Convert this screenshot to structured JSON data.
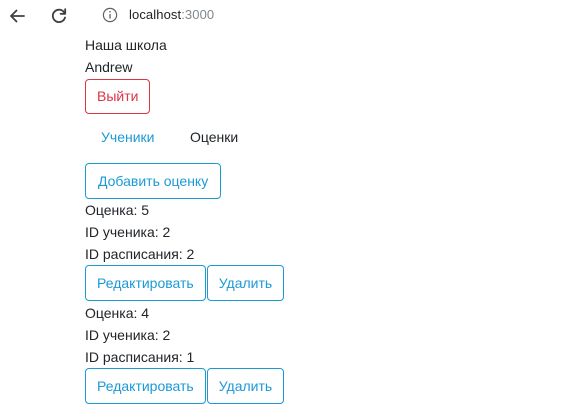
{
  "browser": {
    "url_host": "localhost",
    "url_port": ":3000"
  },
  "header": {
    "school_name": "Наша школа",
    "user_name": "Andrew",
    "logout_label": "Выйти"
  },
  "tabs": [
    {
      "label": "Ученики",
      "active": false
    },
    {
      "label": "Оценки",
      "active": true
    }
  ],
  "actions": {
    "add_grade_label": "Добавить оценку"
  },
  "grades": [
    {
      "grade_text": "Оценка: 5",
      "student_id_text": "ID ученика: 2",
      "schedule_id_text": "ID расписания: 2",
      "edit_label": "Редактировать",
      "delete_label": "Удалить"
    },
    {
      "grade_text": "Оценка: 4",
      "student_id_text": "ID ученика: 2",
      "schedule_id_text": "ID расписания: 1",
      "edit_label": "Редактировать",
      "delete_label": "Удалить"
    }
  ],
  "colors": {
    "link": "#1b9ad6",
    "danger": "#dc3545",
    "text": "#212529"
  },
  "icons": {
    "back": "arrow-left-icon",
    "reload": "reload-icon",
    "info": "info-icon"
  }
}
